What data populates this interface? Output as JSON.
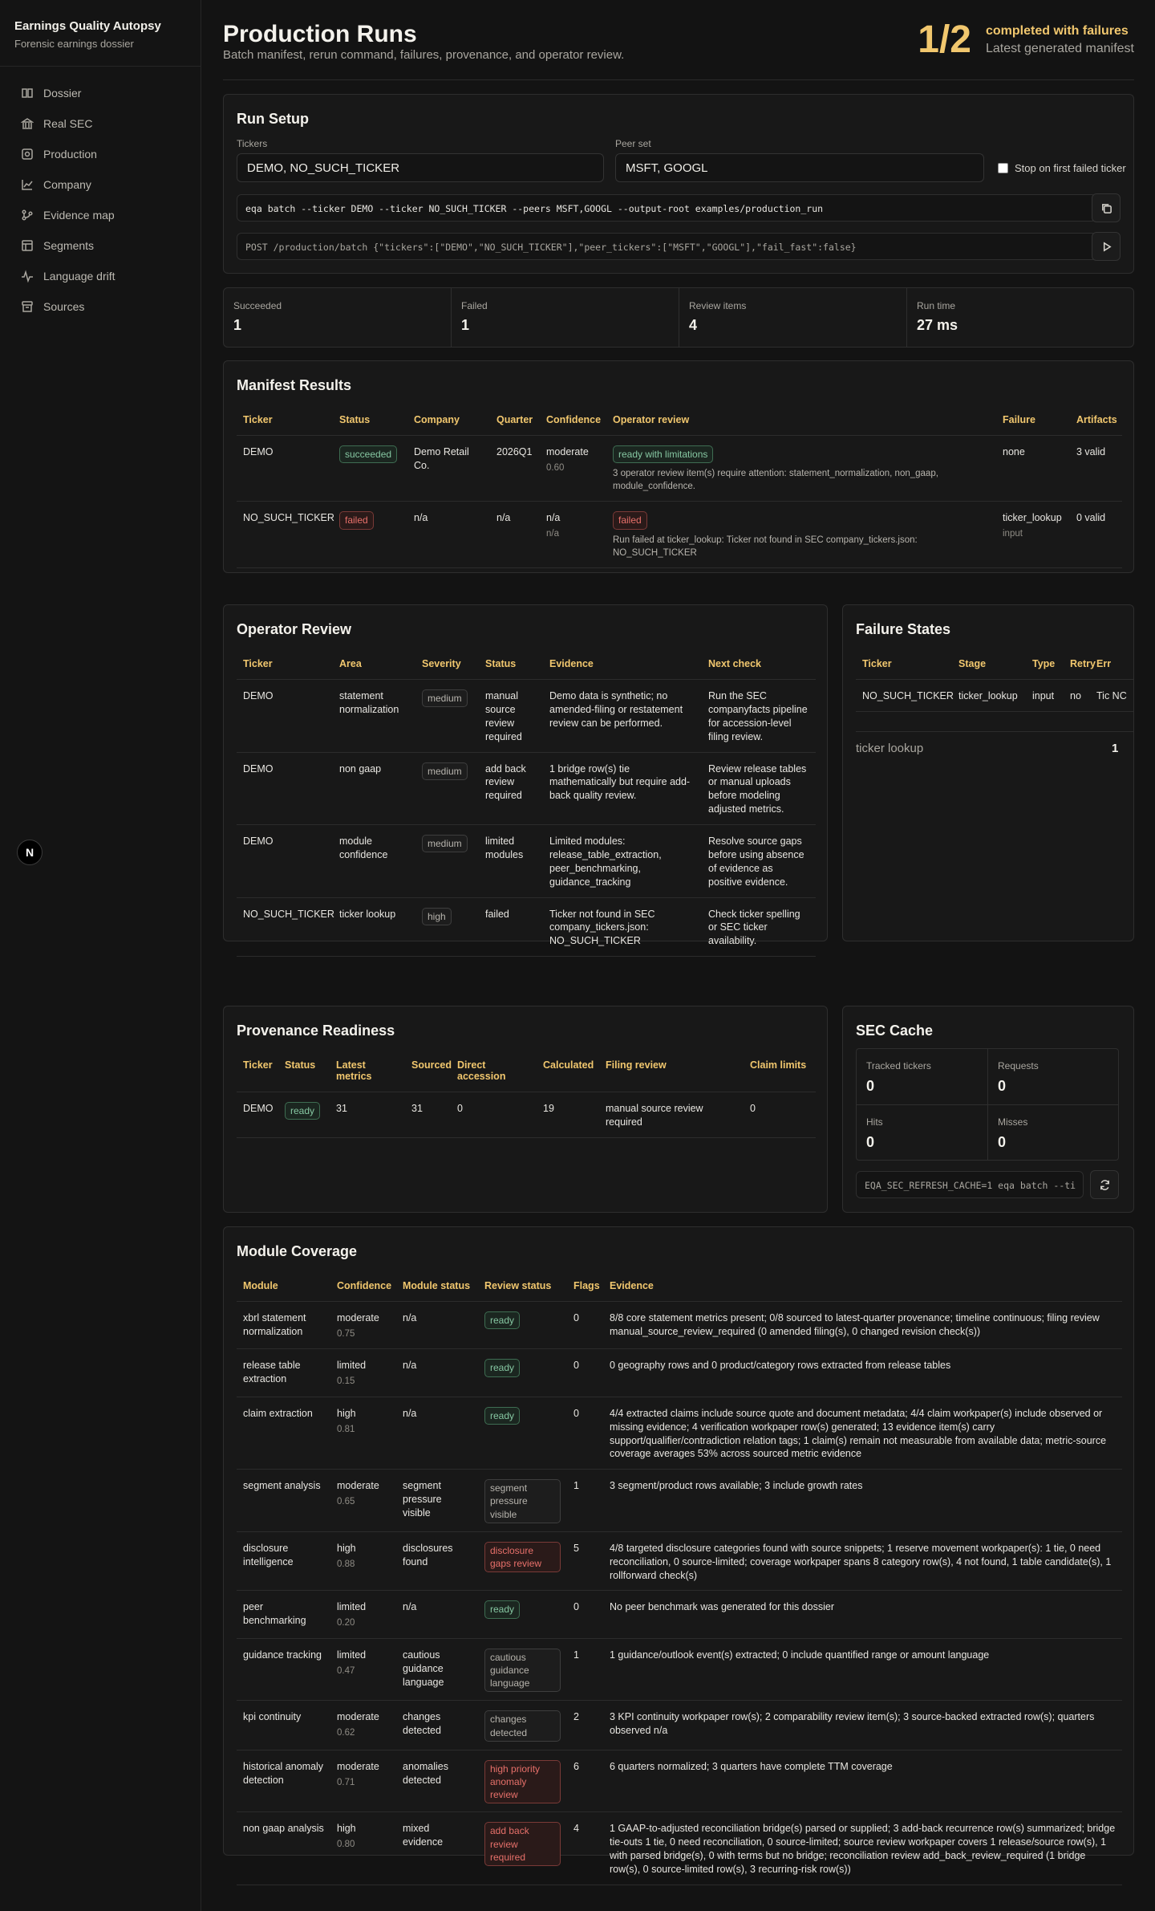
{
  "sidebar": {
    "title": "Earnings Quality Autopsy",
    "subtitle": "Forensic earnings dossier",
    "items": [
      {
        "label": "Dossier",
        "icon": "book-icon"
      },
      {
        "label": "Real SEC",
        "icon": "bank-icon"
      },
      {
        "label": "Production",
        "icon": "production-icon"
      },
      {
        "label": "Company",
        "icon": "line-chart-icon"
      },
      {
        "label": "Evidence map",
        "icon": "graph-icon"
      },
      {
        "label": "Segments",
        "icon": "table-icon"
      },
      {
        "label": "Language drift",
        "icon": "activity-icon"
      },
      {
        "label": "Sources",
        "icon": "archive-icon"
      }
    ],
    "badge": "N"
  },
  "header": {
    "title": "Production Runs",
    "subtitle": "Batch manifest, rerun command, failures, provenance, and operator review.",
    "ratio": "1/2",
    "state": "completed with failures",
    "state_sub": "Latest generated manifest"
  },
  "run_setup": {
    "title": "Run Setup",
    "tickers_label": "Tickers",
    "tickers_value": "DEMO, NO_SUCH_TICKER",
    "peer_label": "Peer set",
    "peer_value": "MSFT, GOOGL",
    "stop_label": "Stop on first failed ticker",
    "cli_command": "eqa batch --ticker DEMO --ticker NO_SUCH_TICKER --peers MSFT,GOOGL --output-root examples/production_run",
    "api_command": "POST /production/batch {\"tickers\":[\"DEMO\",\"NO_SUCH_TICKER\"],\"peer_tickers\":[\"MSFT\",\"GOOGL\"],\"fail_fast\":false}"
  },
  "stats": [
    {
      "label": "Succeeded",
      "value": "1"
    },
    {
      "label": "Failed",
      "value": "1"
    },
    {
      "label": "Review items",
      "value": "4"
    },
    {
      "label": "Run time",
      "value": "27 ms"
    }
  ],
  "manifest": {
    "title": "Manifest Results",
    "headers": [
      "Ticker",
      "Status",
      "Company",
      "Quarter",
      "Confidence",
      "Operator review",
      "Failure",
      "Artifacts"
    ],
    "rows": [
      {
        "ticker": "DEMO",
        "status": "succeeded",
        "company": "Demo Retail Co.",
        "quarter": "2026Q1",
        "confidence": "moderate",
        "confidence_sub": "0.60",
        "review": "ready with limitations",
        "review_text": "3 operator review item(s) require attention: statement_normalization, non_gaap, module_confidence.",
        "failure": "none",
        "failure_sub": "",
        "artifacts": "3 valid"
      },
      {
        "ticker": "NO_SUCH_TICKER",
        "status": "failed",
        "company": "n/a",
        "quarter": "n/a",
        "confidence": "n/a",
        "confidence_sub": "n/a",
        "review": "failed",
        "review_text": "Run failed at ticker_lookup: Ticker not found in SEC company_tickers.json: NO_SUCH_TICKER",
        "failure": "ticker_lookup",
        "failure_sub": "input",
        "artifacts": "0 valid"
      }
    ]
  },
  "operator_review": {
    "title": "Operator Review",
    "headers": [
      "Ticker",
      "Area",
      "Severity",
      "Status",
      "Evidence",
      "Next check"
    ],
    "rows": [
      {
        "ticker": "DEMO",
        "area": "statement normalization",
        "severity": "medium",
        "status": "manual source review required",
        "evidence": "Demo data is synthetic; no amended-filing or restatement review can be performed.",
        "next": "Run the SEC companyfacts pipeline for accession-level filing review."
      },
      {
        "ticker": "DEMO",
        "area": "non gaap",
        "severity": "medium",
        "status": "add back review required",
        "evidence": "1 bridge row(s) tie mathematically but require add-back quality review.",
        "next": "Review release tables or manual uploads before modeling adjusted metrics."
      },
      {
        "ticker": "DEMO",
        "area": "module confidence",
        "severity": "medium",
        "status": "limited modules",
        "evidence": "Limited modules: release_table_extraction, peer_benchmarking, guidance_tracking",
        "next": "Resolve source gaps before using absence of evidence as positive evidence."
      },
      {
        "ticker": "NO_SUCH_TICKER",
        "area": "ticker lookup",
        "severity": "high",
        "status": "failed",
        "evidence": "Ticker not found in SEC company_tickers.json: NO_SUCH_TICKER",
        "next": "Check ticker spelling or SEC ticker availability."
      }
    ]
  },
  "failure_states": {
    "title": "Failure States",
    "headers": [
      "Ticker",
      "Stage",
      "Type",
      "Retry",
      "Err"
    ],
    "rows": [
      {
        "ticker": "NO_SUCH_TICKER",
        "stage": "ticker_lookup",
        "type": "input",
        "retry": "no",
        "err": "Tic NC"
      }
    ],
    "summary_label": "ticker lookup",
    "summary_value": "1"
  },
  "provenance": {
    "title": "Provenance Readiness",
    "headers": [
      "Ticker",
      "Status",
      "Latest metrics",
      "Sourced",
      "Direct accession",
      "Calculated",
      "Filing review",
      "Claim limits"
    ],
    "rows": [
      {
        "ticker": "DEMO",
        "status": "ready",
        "latest": "31",
        "sourced": "31",
        "direct": "0",
        "calculated": "19",
        "filing": "manual source review required",
        "claim": "0"
      }
    ]
  },
  "sec_cache": {
    "title": "SEC Cache",
    "cells": [
      {
        "label": "Tracked tickers",
        "value": "0"
      },
      {
        "label": "Requests",
        "value": "0"
      },
      {
        "label": "Hits",
        "value": "0"
      },
      {
        "label": "Misses",
        "value": "0"
      }
    ],
    "command": "EQA_SEC_REFRESH_CACHE=1 eqa batch --ti"
  },
  "modules": {
    "title": "Module Coverage",
    "headers": [
      "Module",
      "Confidence",
      "Module status",
      "Review status",
      "Flags",
      "Evidence"
    ],
    "rows": [
      {
        "module": "xbrl statement normalization",
        "confidence": "moderate",
        "score": "0.75",
        "mstatus": "n/a",
        "review": "ready",
        "tone": "green",
        "flags": "0",
        "evidence": "8/8 core statement metrics present; 0/8 sourced to latest-quarter provenance; timeline continuous; filing review manual_source_review_required (0 amended filing(s), 0 changed revision check(s))"
      },
      {
        "module": "release table extraction",
        "confidence": "limited",
        "score": "0.15",
        "mstatus": "n/a",
        "review": "ready",
        "tone": "green",
        "flags": "0",
        "evidence": "0 geography rows and 0 product/category rows extracted from release tables"
      },
      {
        "module": "claim extraction",
        "confidence": "high",
        "score": "0.81",
        "mstatus": "n/a",
        "review": "ready",
        "tone": "green",
        "flags": "0",
        "evidence": "4/4 extracted claims include source quote and document metadata; 4/4 claim workpaper(s) include observed or missing evidence; 4 verification workpaper row(s) generated; 13 evidence item(s) carry support/qualifier/contradiction relation tags; 1 claim(s) remain not measurable from available data; metric-source coverage averages 53% across sourced metric evidence"
      },
      {
        "module": "segment analysis",
        "confidence": "moderate",
        "score": "0.65",
        "mstatus": "segment pressure visible",
        "review": "segment pressure visible",
        "tone": "gray",
        "flags": "1",
        "evidence": "3 segment/product rows available; 3 include growth rates"
      },
      {
        "module": "disclosure intelligence",
        "confidence": "high",
        "score": "0.88",
        "mstatus": "disclosures found",
        "review": "disclosure gaps review",
        "tone": "red",
        "flags": "5",
        "evidence": "4/8 targeted disclosure categories found with source snippets; 1 reserve movement workpaper(s): 1 tie, 0 need reconciliation, 0 source-limited; coverage workpaper spans 8 category row(s), 4 not found, 1 table candidate(s), 1 rollforward check(s)"
      },
      {
        "module": "peer benchmarking",
        "confidence": "limited",
        "score": "0.20",
        "mstatus": "n/a",
        "review": "ready",
        "tone": "green",
        "flags": "0",
        "evidence": "No peer benchmark was generated for this dossier"
      },
      {
        "module": "guidance tracking",
        "confidence": "limited",
        "score": "0.47",
        "mstatus": "cautious guidance language",
        "review": "cautious guidance language",
        "tone": "gray",
        "flags": "1",
        "evidence": "1 guidance/outlook event(s) extracted; 0 include quantified range or amount language"
      },
      {
        "module": "kpi continuity",
        "confidence": "moderate",
        "score": "0.62",
        "mstatus": "changes detected",
        "review": "changes detected",
        "tone": "gray",
        "flags": "2",
        "evidence": "3 KPI continuity workpaper row(s); 2 comparability review item(s); 3 source-backed extracted row(s); quarters observed n/a"
      },
      {
        "module": "historical anomaly detection",
        "confidence": "moderate",
        "score": "0.71",
        "mstatus": "anomalies detected",
        "review": "high priority anomaly review",
        "tone": "red",
        "flags": "6",
        "evidence": "6 quarters normalized; 3 quarters have complete TTM coverage"
      },
      {
        "module": "non gaap analysis",
        "confidence": "high",
        "score": "0.80",
        "mstatus": "mixed evidence",
        "review": "add back review required",
        "tone": "red",
        "flags": "4",
        "evidence": "1 GAAP-to-adjusted reconciliation bridge(s) parsed or supplied; 3 add-back recurrence row(s) summarized; bridge tie-outs 1 tie, 0 need reconciliation, 0 source-limited; source review workpaper covers 1 release/source row(s), 1 with parsed bridge(s), 0 with terms but no bridge; reconciliation review add_back_review_required (1 bridge row(s), 0 source-limited row(s), 3 recurring-risk row(s))"
      }
    ]
  }
}
